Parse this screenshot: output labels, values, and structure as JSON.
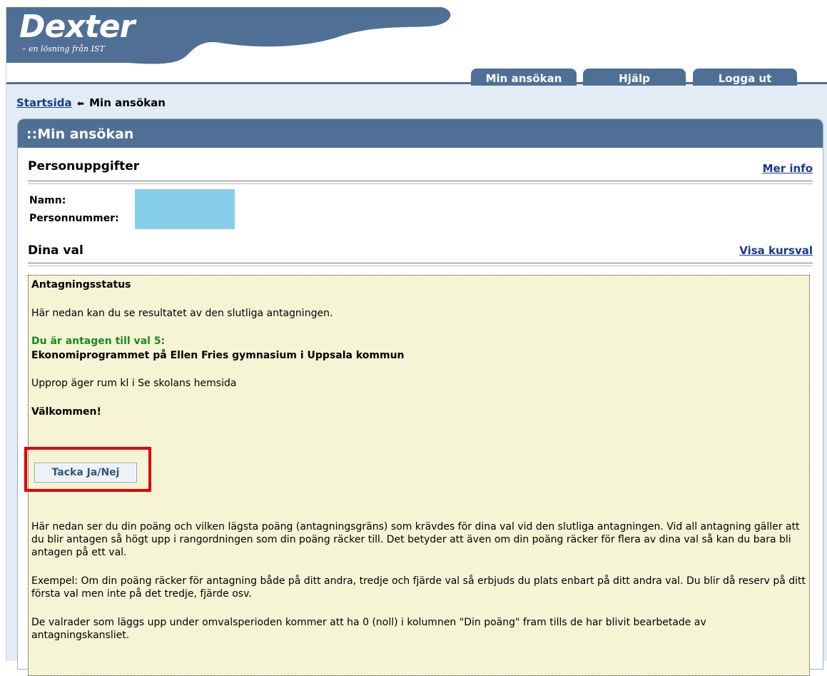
{
  "header": {
    "logo_title": "Dexter",
    "logo_subtitle": "– en lösning från IST",
    "tabs": [
      {
        "label": "Min ansökan"
      },
      {
        "label": "Hjälp"
      },
      {
        "label": "Logga ut"
      }
    ]
  },
  "breadcrumb": {
    "home": "Startsida",
    "current": "Min ansökan"
  },
  "panel": {
    "title": "::Min ansökan",
    "person": {
      "title": "Personuppgifter",
      "more_link": "Mer info",
      "name_label": "Namn:",
      "pnr_label": "Personnummer:"
    },
    "choices": {
      "title": "Dina val",
      "link": "Visa kursval"
    }
  },
  "status": {
    "heading": "Antagningsstatus",
    "intro": "Här nedan kan du se resultatet av den slutliga antagningen.",
    "admitted": "Du är antagen till val 5:",
    "program": "Ekonomiprogrammet på Ellen Fries gymnasium i Uppsala kommun",
    "roll_call": "Upprop äger rum kl i Se skolans hemsida",
    "welcome": "Välkommen!",
    "button": "Tacka Ja/Nej",
    "para1": "Här nedan ser du din poäng och vilken lägsta poäng (antagningsgräns) som krävdes för dina val vid den slutliga antagningen. Vid all antagning gäller att du blir antagen så högt upp i rangordningen som din poäng räcker till. Det betyder att även om din poäng räcker för flera av dina val så kan du bara bli antagen på ett val.",
    "para2": "Exempel: Om din poäng räcker för antagning både på ditt andra, tredje och fjärde val så erbjuds du plats enbart på ditt andra val. Du blir då reserv på ditt första val men inte på det tredje, fjärde osv.",
    "para3": "De valrader som läggs upp under omvalsperioden kommer att ha 0 (noll) i kolumnen \"Din poäng\" fram tills de har blivit bearbetade av antagningskansliet."
  }
}
